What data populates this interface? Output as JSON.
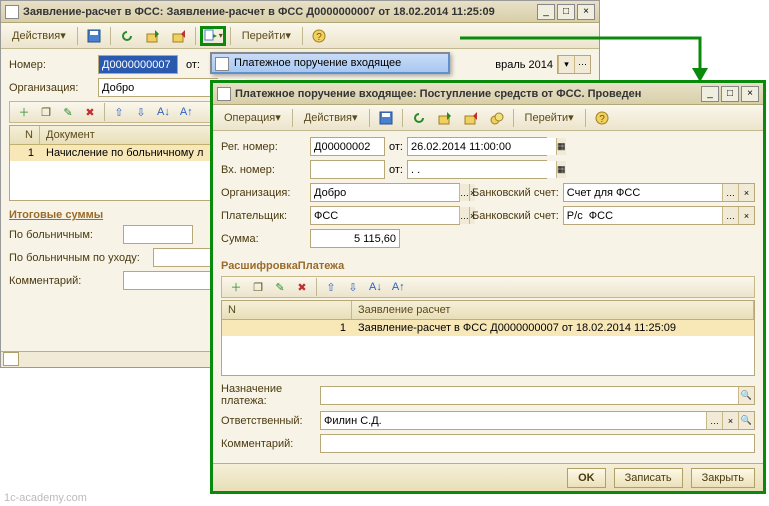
{
  "win1": {
    "title": "Заявление-расчет в ФСС: Заявление-расчет в ФСС Д0000000007 от 18.02.2014 11:25:09",
    "actions": "Действия",
    "goto": "Перейти",
    "number_label": "Номер:",
    "number_value": "Д0000000007",
    "from_label": "от:",
    "period_fragment": "враль 2014",
    "org_label": "Организация:",
    "org_value": "Добро",
    "table_head_n": "N",
    "table_head_doc": "Документ",
    "row1_n": "1",
    "row1_doc": "Начисление по больничному л",
    "section_totals": "Итоговые суммы",
    "sick_label": "По больничным:",
    "sick_care_label": "По больничным по уходу:",
    "comment_label": "Комментарий:"
  },
  "dropdown": {
    "item1": "Платежное поручение входящее"
  },
  "win2": {
    "title": "Платежное поручение входящее: Поступление средств от ФСС. Проведен",
    "operation": "Операция",
    "actions": "Действия",
    "goto": "Перейти",
    "reg_num_label": "Рег. номер:",
    "reg_num": "Д00000002",
    "from_label": "от:",
    "date_value": "26.02.2014 11:00:00",
    "in_num_label": "Вх. номер:",
    "in_date": ". .",
    "org_label": "Организация:",
    "org_value": "Добро",
    "bank_acc_label": "Банковский счет:",
    "bank_acc_value": "Счет для ФСС",
    "payer_label": "Плательщик:",
    "payer_value": "ФСС",
    "bank_acc2_label": "Банковский счет:",
    "bank_acc2_value": "Р/с  ФСС",
    "sum_label": "Сумма:",
    "sum_value": "5 115,60",
    "section_detail": "РасшифровкаПлатежа",
    "col_n": "N",
    "col_request": "Заявление расчет",
    "row_n": "1",
    "row_request": "Заявление-расчет в ФСС Д0000000007 от 18.02.2014 11:25:09",
    "purpose_label": "Назначение платежа:",
    "resp_label": "Ответственный:",
    "resp_value": "Филин С.Д.",
    "comment_label": "Комментарий:",
    "ok": "OK",
    "save": "Записать",
    "close": "Закрыть"
  },
  "watermark": "1c-academy.com"
}
